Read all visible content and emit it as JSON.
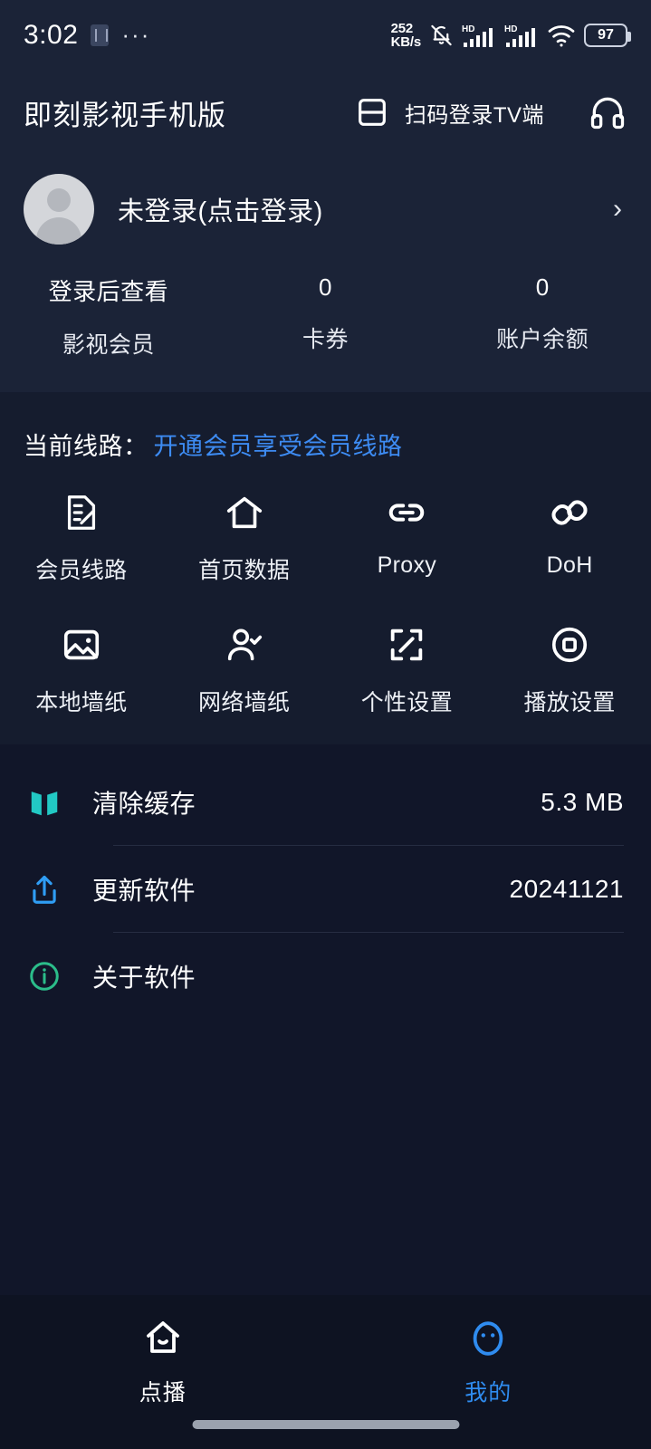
{
  "statusbar": {
    "time": "3:02",
    "app_icon": "app-badge-icon",
    "overflow": "···",
    "net_speed_value": "252",
    "net_speed_unit": "KB/s",
    "mute_icon": "bell-muted-icon",
    "signal1_label": "HD",
    "signal2_label": "HD",
    "wifi_icon": "wifi-icon",
    "battery_level": "97"
  },
  "header": {
    "title": "即刻影视手机版",
    "scan_icon": "scan-qr-icon",
    "scan_label": "扫码登录TV端",
    "service_icon": "headphones-icon"
  },
  "profile": {
    "avatar_icon": "avatar-placeholder-icon",
    "name": "未登录(点击登录)",
    "chevron_icon": "chevron-right-icon",
    "stats": [
      {
        "value": "登录后查看",
        "label": "影视会员"
      },
      {
        "value": "0",
        "label": "卡券"
      },
      {
        "value": "0",
        "label": "账户余额"
      }
    ]
  },
  "route": {
    "label": "当前线路：",
    "value": "开通会员享受会员线路",
    "value_color": "#3d8bf2"
  },
  "grid": {
    "items": [
      {
        "label": "会员线路",
        "icon": "document-edit-icon"
      },
      {
        "label": "首页数据",
        "icon": "home-icon"
      },
      {
        "label": "Proxy",
        "icon": "link-icon"
      },
      {
        "label": "DoH",
        "icon": "chain-diagonal-icon"
      },
      {
        "label": "本地墙纸",
        "icon": "image-icon"
      },
      {
        "label": "网络墙纸",
        "icon": "user-check-icon"
      },
      {
        "label": "个性设置",
        "icon": "expand-arrows-icon"
      },
      {
        "label": "播放设置",
        "icon": "stop-circle-icon"
      }
    ]
  },
  "settings_list": {
    "rows": [
      {
        "label": "清除缓存",
        "value": "5.3 MB",
        "icon": "map-book-icon",
        "icon_color": "#22c9c4"
      },
      {
        "label": "更新软件",
        "value": "20241121",
        "icon": "upload-icon",
        "icon_color": "#2f9df4"
      },
      {
        "label": "关于软件",
        "value": "",
        "icon": "info-circle-icon",
        "icon_color": "#2bbd8a"
      }
    ]
  },
  "bottom_nav": {
    "items": [
      {
        "label": "点播",
        "icon": "home-nav-icon",
        "active": false
      },
      {
        "label": "我的",
        "icon": "face-nav-icon",
        "active": true
      }
    ],
    "active_color": "#2f8cf0"
  }
}
